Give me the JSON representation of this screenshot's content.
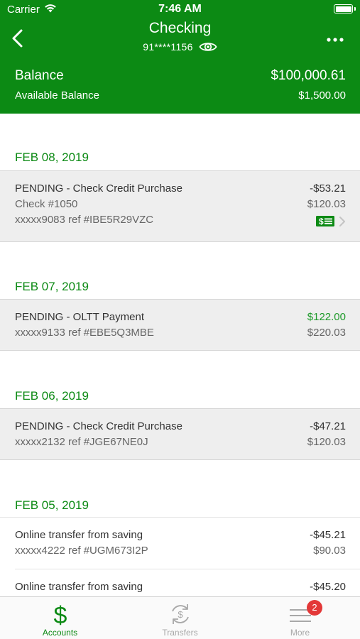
{
  "status_bar": {
    "carrier": "Carrier",
    "time": "7:46 AM"
  },
  "nav": {
    "title": "Checking",
    "account_number": "91****1156"
  },
  "balance": {
    "label": "Balance",
    "value": "$100,000.61",
    "available_label": "Available Balance",
    "available_value": "$1,500.00"
  },
  "groups": [
    {
      "date": "FEB 08, 2019",
      "transactions": [
        {
          "description": "PENDING - Check Credit Purchase",
          "line2": "Check #1050",
          "line3": "xxxxx9083 ref #IBE5R29VZC",
          "amount": "-$53.21",
          "running": "$120.03",
          "has_check_image": true
        }
      ]
    },
    {
      "date": "FEB 07, 2019",
      "transactions": [
        {
          "description": "PENDING - OLTT Payment",
          "line2": "xxxxx9133 ref #EBE5Q3MBE",
          "amount": "$122.00",
          "running": "$220.03"
        }
      ]
    },
    {
      "date": "FEB 06, 2019",
      "transactions": [
        {
          "description": "PENDING - Check Credit Purchase",
          "line2": "xxxxx2132 ref #JGE67NE0J",
          "amount": "-$47.21",
          "running": "$120.03"
        }
      ]
    },
    {
      "date": "FEB 05, 2019",
      "transactions": [
        {
          "description": "Online transfer from saving",
          "line2": "xxxxx4222 ref #UGM673I2P",
          "amount": "-$45.21",
          "running": "$90.03"
        },
        {
          "description": "Online transfer from saving",
          "amount": "-$45.20"
        }
      ]
    }
  ],
  "tabbar": {
    "tabs": [
      {
        "label": "Accounts",
        "icon": "dollar-icon",
        "active": true
      },
      {
        "label": "Transfers",
        "icon": "transfer-icon",
        "active": false
      },
      {
        "label": "More",
        "icon": "menu-icon",
        "active": false,
        "badge": "2"
      }
    ]
  },
  "colors": {
    "brand_green": "#0c8a14",
    "positive_amount": "#1e9a2a",
    "badge_red": "#e33838"
  }
}
